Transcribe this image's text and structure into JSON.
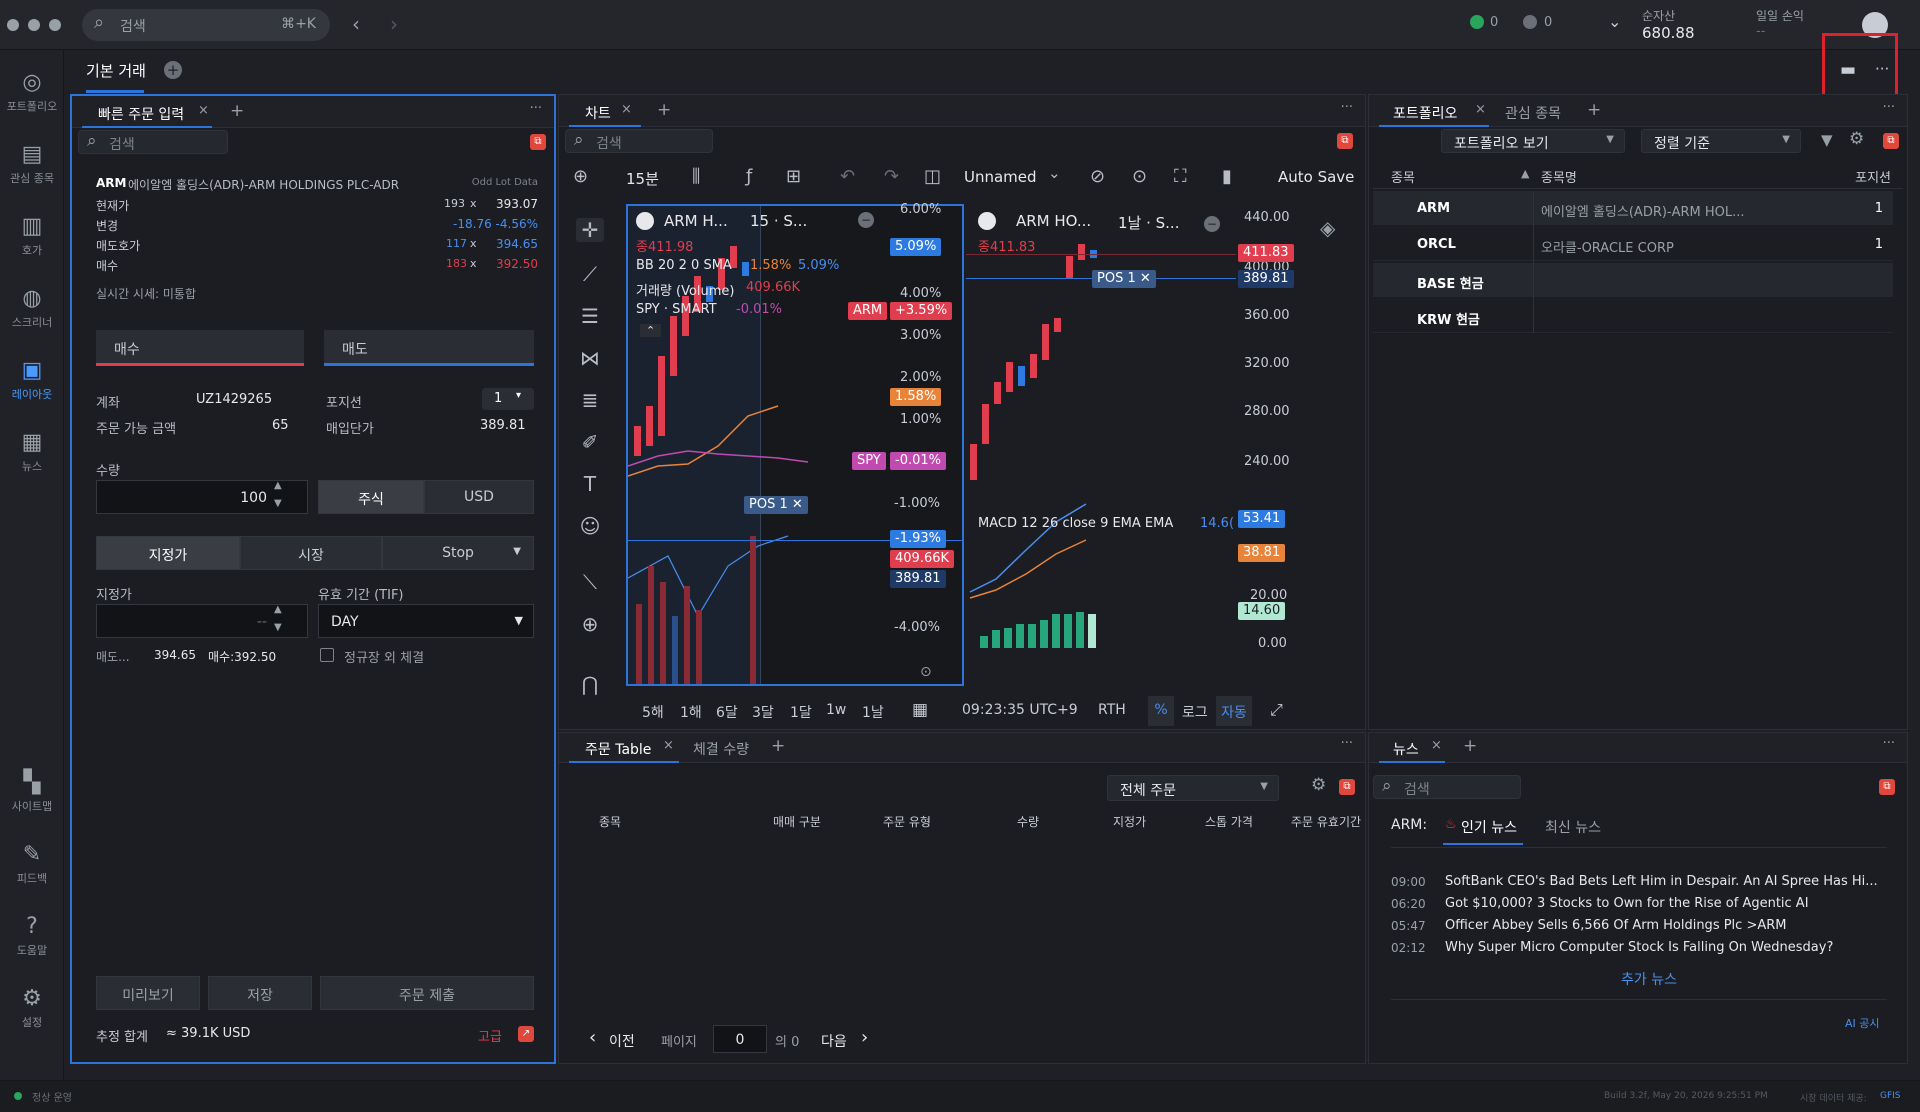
{
  "topbar": {
    "search_placeholder": "검색",
    "shortcut": "⌘+K",
    "status_green": "0",
    "status_check": "0",
    "net_assets_label": "순자산",
    "net_assets_value": "680.88",
    "daily_pl_label": "일일 손익",
    "daily_pl_value": "--"
  },
  "nav": [
    {
      "label": "포트폴리오"
    },
    {
      "label": "관심 종목"
    },
    {
      "label": "호가"
    },
    {
      "label": "스크리너"
    },
    {
      "label": "레이아웃"
    },
    {
      "label": "뉴스"
    },
    {
      "label": "사이트맵"
    },
    {
      "label": "피드백"
    },
    {
      "label": "도움말"
    },
    {
      "label": "설정"
    }
  ],
  "workspace_tab": "기본 거래",
  "order": {
    "tab": "빠른 주문 입력",
    "search_placeholder": "검색",
    "symbol": "ARM",
    "symbol_name": "에이알엠 홀딩스(ADR)-ARM HOLDINGS PLC-ADR",
    "odd_lot": "Odd Lot Data",
    "quote": [
      {
        "label": "현재가",
        "qty": "193",
        "x": "x",
        "val": "393.07"
      },
      {
        "label": "변경",
        "val": "-18.76 -4.56%"
      },
      {
        "label": "매도호가",
        "qty": "117",
        "x": "x",
        "val": "394.65"
      },
      {
        "label": "매수",
        "qty": "183",
        "x": "x",
        "val": "392.50"
      }
    ],
    "realtime": "실시간 시세: 미통합",
    "buy_tab": "매수",
    "sell_tab": "매도",
    "account_label": "계좌",
    "account_value": "UZ1429265",
    "position_label": "포지션",
    "position_value": "1",
    "avail_label": "주문 가능 금액",
    "avail_value": "65",
    "avgcost_label": "매입단가",
    "avgcost_value": "389.81",
    "qty_label": "수량",
    "qty_value": "100",
    "unit_stock": "주식",
    "unit_usd": "USD",
    "type_limit": "지정가",
    "type_market": "시장",
    "type_stop": "Stop",
    "limit_label": "지정가",
    "limit_placeholder": "--",
    "tif_label": "유효 기간 (TIF)",
    "tif_value": "DAY",
    "ask_short": "매도...",
    "ask_val": "394.65",
    "bid_short": "매수:392.50",
    "outside_rth": "정규장 외 체결",
    "preview": "미리보기",
    "save": "저장",
    "submit": "주문 제출",
    "est_label": "추정 합계",
    "est_value": "≈ 39.1K USD",
    "advanced": "고급"
  },
  "chart": {
    "tab": "차트",
    "search_placeholder": "검색",
    "interval": "15분",
    "layout_name": "Unnamed",
    "autosave": "Auto Save",
    "left": {
      "title": "ARM H...",
      "sub": "15 · S...",
      "close": "종411.98",
      "bb": "BB 20 2 0 SMA",
      "bb_v1": "1.58%",
      "bb_v2": "5.09%",
      "vol": "거래량 (Volume)",
      "vol_v": "409.66K",
      "spy": "SPY · SMART",
      "spy_v": "-0.01%",
      "axis": [
        "6.00%",
        "4.00%",
        "3.00%",
        "2.00%",
        "1.00%",
        "-1.00%",
        "-4.00%"
      ],
      "tag_5": "5.09%",
      "tag_arm_l": "ARM",
      "tag_arm": "+3.59%",
      "tag_158": "1.58%",
      "tag_spy_l": "SPY",
      "tag_spy": "-0.01%",
      "tag_193": "-1.93%",
      "tag_409": "409.66K",
      "tag_389": "389.81",
      "pos": "POS",
      "pos_n": "1"
    },
    "right": {
      "title": "ARM HO...",
      "sub": "1날 · S...",
      "close": "종411.83",
      "axis": [
        "440.00",
        "400.00",
        "360.00",
        "320.00",
        "280.00",
        "240.00",
        "20.00",
        "0.00"
      ],
      "tag_411": "411.83",
      "tag_389": "389.81",
      "macd": "MACD 12 26 close 9 EMA EMA",
      "macd_v": "14.6(",
      "tag_53": "53.41",
      "tag_38": "38.81",
      "tag_14": "14.60",
      "pos": "POS",
      "pos_n": "1"
    },
    "ranges": [
      "5해",
      "1해",
      "6달",
      "3달",
      "1달",
      "1w",
      "1날"
    ],
    "time": "09:23:35 UTC+9",
    "rth": "RTH",
    "pct": "%",
    "log": "로그",
    "auto": "자동"
  },
  "portfolio": {
    "tab": "포트폴리오",
    "tab2": "관심 종목",
    "view": "포트폴리오 보기",
    "sort": "정렬 기준",
    "cols": [
      "종목",
      "종목명",
      "포지션"
    ],
    "rows": [
      {
        "sym": "ARM",
        "name": "에이알엠 홀딩스(ADR)-ARM HOL...",
        "pos": "1"
      },
      {
        "sym": "ORCL",
        "name": "오라클-ORACLE CORP",
        "pos": "1"
      },
      {
        "sym": "BASE 현금",
        "name": "",
        "pos": ""
      },
      {
        "sym": "KRW 현금",
        "name": "",
        "pos": ""
      }
    ]
  },
  "orders": {
    "tab": "주문 Table",
    "tab2": "체결 수량",
    "filter": "전체 주문",
    "cols": [
      "종목",
      "매매 구분",
      "주문 유형",
      "수량",
      "지정가",
      "스톱 가격",
      "주문 유효기간"
    ],
    "prev": "이전",
    "page_label": "페이지",
    "page": "0",
    "of": "의 0",
    "next": "다음"
  },
  "news": {
    "tab": "뉴스",
    "search_placeholder": "검색",
    "sym": "ARM:",
    "hot": "인기 뉴스",
    "latest": "최신 뉴스",
    "items": [
      {
        "time": "09:00",
        "headline": "SoftBank CEO's Bad Bets Left Him in Despair. An AI Spree Has Hi..."
      },
      {
        "time": "06:20",
        "headline": "Got $10,000? 3 Stocks to Own for the Rise of Agentic AI"
      },
      {
        "time": "05:47",
        "headline": "Officer Abbey Sells 6,566 Of Arm Holdings Plc >ARM"
      },
      {
        "time": "02:12",
        "headline": "Why Super Micro Computer Stock Is Falling On Wednesday?"
      }
    ],
    "more": "추가 뉴스",
    "ai": "AI 공시"
  },
  "status": {
    "left": "정상 운영",
    "build": "Build 3.2f, May 20, 2026 9:25:51 PM",
    "data": "시장 데이터 제공:",
    "provider": "GFIS"
  }
}
